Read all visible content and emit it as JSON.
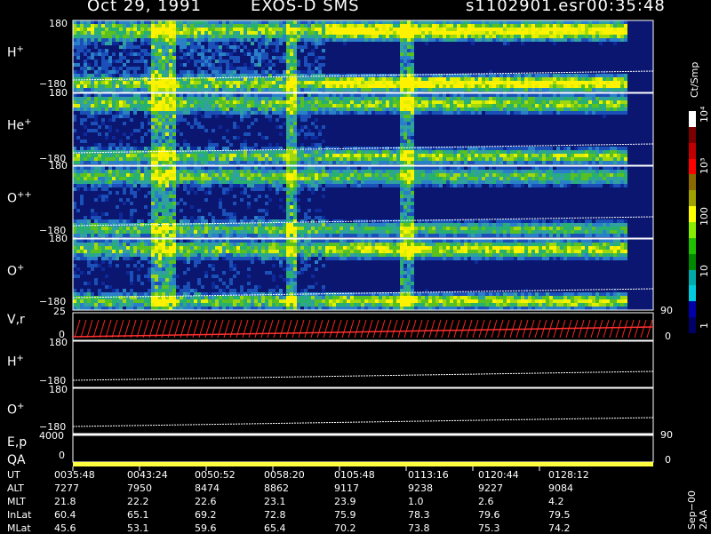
{
  "header": {
    "date": "Oct 29, 1991",
    "instrument": "EXOS-D SMS",
    "file": "s1102901.esr",
    "time": "00:35:48"
  },
  "panels": [
    {
      "label": "H",
      "sup": "+",
      "ytop": "180",
      "ybot": "−180"
    },
    {
      "label": "He",
      "sup": "+",
      "ytop": "180",
      "ybot": "−180"
    },
    {
      "label": "O",
      "sup": "++",
      "ytop": "180",
      "ybot": "−180"
    },
    {
      "label": "O",
      "sup": "+",
      "ytop": "180",
      "ybot": "−180"
    },
    {
      "label": "V,r",
      "sup": "",
      "ytop": "25",
      "ybot": "0"
    },
    {
      "label": "H",
      "sup": "+",
      "ytop": "180",
      "ybot": "−180"
    },
    {
      "label": "O",
      "sup": "+",
      "ytop": "180",
      "ybot": "−180"
    },
    {
      "label": "E,p",
      "sup": "",
      "ytop": "4000",
      "ybot": "0"
    }
  ],
  "qa_label": "QA",
  "right_ticks": {
    "vr_top": "90",
    "vr_bot": "0",
    "ep_top": "90",
    "ep_bot": "0"
  },
  "colorbar": {
    "unit": "Ct/Smp",
    "ticks": [
      "10⁴",
      "10³",
      "100",
      "10",
      "1"
    ],
    "colors": [
      "#ffffff",
      "#7a0000",
      "#c00000",
      "#ff0000",
      "#8a6a00",
      "#a0a000",
      "#ffff00",
      "#88ee00",
      "#20c000",
      "#008800",
      "#00aaaa",
      "#00ccdd",
      "#0000aa",
      "#000066"
    ]
  },
  "footer_note": "Sep−00 2AA",
  "chart_data": {
    "type": "heatmap",
    "title": "Oct 29, 1991   EXOS-D SMS",
    "x": [
      "0035:48",
      "0043:24",
      "0050:52",
      "0058:20",
      "0105:48",
      "0113:16",
      "0120:44",
      "0128:12"
    ],
    "rows": [
      {
        "name": "UT",
        "values": [
          "0035:48",
          "0043:24",
          "0050:52",
          "0058:20",
          "0105:48",
          "0113:16",
          "0120:44",
          "0128:12"
        ]
      },
      {
        "name": "ALT",
        "values": [
          "7277",
          "7950",
          "8474",
          "8862",
          "9117",
          "9238",
          "9227",
          "9084"
        ]
      },
      {
        "name": "MLT",
        "values": [
          "21.8",
          "22.2",
          "22.6",
          "23.1",
          "23.9",
          "1.0",
          "2.6",
          "4.2"
        ]
      },
      {
        "name": "InLat",
        "values": [
          "60.4",
          "65.1",
          "69.2",
          "72.8",
          "75.9",
          "78.3",
          "79.6",
          "79.5"
        ]
      },
      {
        "name": "MLat",
        "values": [
          "45.6",
          "53.1",
          "59.6",
          "65.4",
          "70.2",
          "73.8",
          "75.3",
          "74.2"
        ]
      }
    ],
    "ylim_pitch": [
      -180,
      180
    ],
    "ylim_vr": [
      0,
      25
    ],
    "ylim_ep": [
      0,
      4000
    ],
    "colorscale_ticks": [
      1,
      10,
      100,
      1000,
      10000
    ]
  }
}
